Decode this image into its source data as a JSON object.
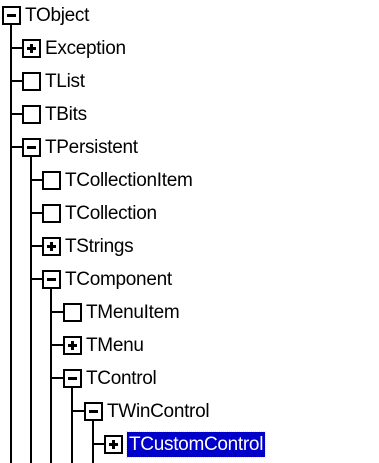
{
  "tree": {
    "nodes": [
      {
        "label": "TObject",
        "level": 0,
        "toggle": "minus"
      },
      {
        "label": "Exception",
        "level": 1,
        "toggle": "plus"
      },
      {
        "label": "TList",
        "level": 1,
        "toggle": "empty"
      },
      {
        "label": "TBits",
        "level": 1,
        "toggle": "empty"
      },
      {
        "label": "TPersistent",
        "level": 1,
        "toggle": "minus"
      },
      {
        "label": "TCollectionItem",
        "level": 2,
        "toggle": "empty"
      },
      {
        "label": "TCollection",
        "level": 2,
        "toggle": "empty"
      },
      {
        "label": "TStrings",
        "level": 2,
        "toggle": "plus"
      },
      {
        "label": "TComponent",
        "level": 2,
        "toggle": "minus"
      },
      {
        "label": "TMenuItem",
        "level": 3,
        "toggle": "empty"
      },
      {
        "label": "TMenu",
        "level": 3,
        "toggle": "plus"
      },
      {
        "label": "TControl",
        "level": 3,
        "toggle": "minus"
      },
      {
        "label": "TWinControl",
        "level": 4,
        "toggle": "minus"
      },
      {
        "label": "TCustomControl",
        "level": 5,
        "toggle": "plus",
        "selected": true
      }
    ]
  },
  "colors": {
    "selection_bg": "#0000c8",
    "selection_text": "#ffffff",
    "line": "#000000",
    "background": "#ffffff"
  }
}
